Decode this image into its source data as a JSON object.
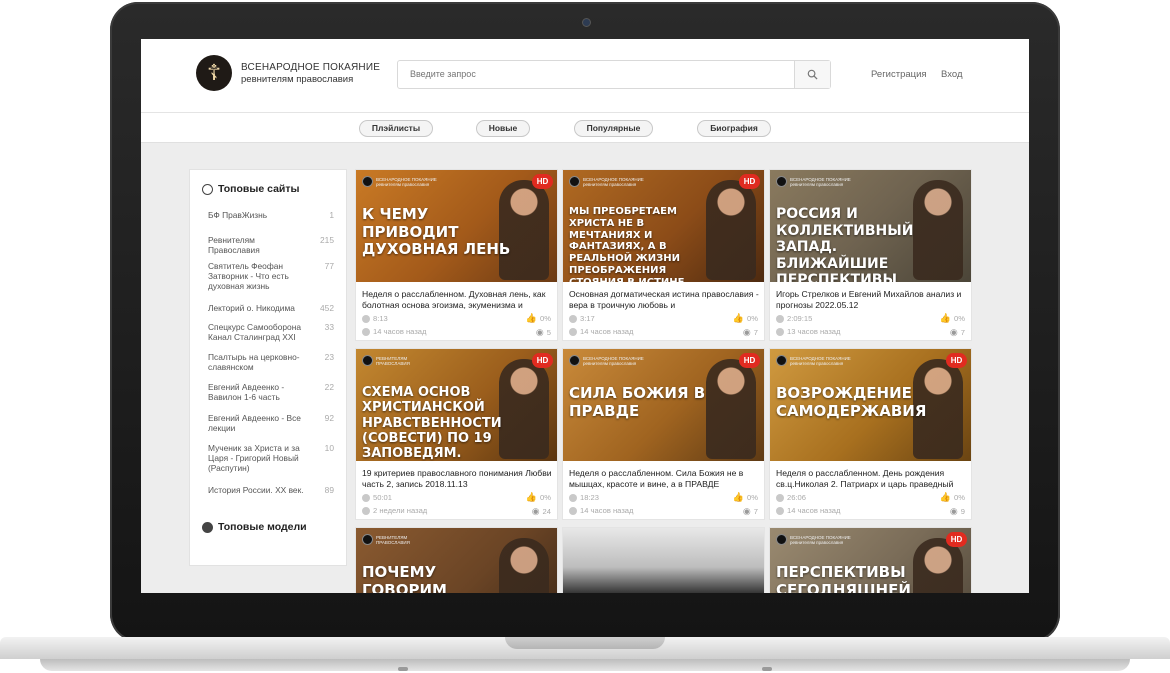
{
  "site": {
    "title": "ВСЕНАРОДНОЕ ПОКАЯНИЕ",
    "subtitle": "ревнителям православия",
    "logo_icon": "orthodox-cross-icon"
  },
  "search": {
    "placeholder": "Введите запрос"
  },
  "auth": {
    "register": "Регистрация",
    "login": "Вход"
  },
  "nav": {
    "tabs": [
      "Плэйлисты",
      "Новые",
      "Популярные",
      "Биография"
    ]
  },
  "sidebar": {
    "top_sites_heading": "Топовые сайты",
    "items": [
      {
        "label": "БФ ПравЖизнь",
        "count": "1"
      },
      {
        "label": "Ревнителям Православия",
        "count": "215"
      },
      {
        "label": "Святитель Феофан Затворник - Что есть духовная жизнь",
        "count": "77"
      },
      {
        "label": "Лекторий о. Никодима",
        "count": "452"
      },
      {
        "label": "Спецкурс Самооборона Канал Сталинград XXI",
        "count": "33"
      },
      {
        "label": "Псалтырь на церковно-славянском",
        "count": "23"
      },
      {
        "label": "Евгений Авдеенко - Вавилон 1-6 часть",
        "count": "22"
      },
      {
        "label": "Евгений Авдеенко - Все лекции",
        "count": "92"
      },
      {
        "label": "Мученик за Христа и за Царя - Григорий Новый (Распутин)",
        "count": "10"
      },
      {
        "label": "История России. XX век.",
        "count": "89"
      }
    ],
    "top_models_heading": "Топовые модели"
  },
  "brand_small": {
    "line1": "ВСЕНАРОДНОЕ ПОКАЯНИЕ",
    "line2": "ревнителям православия"
  },
  "brand_alt": {
    "line1": "РЕВНИТЕЛЯМ",
    "line2": "ПРАВОСЛАВИЯ"
  },
  "hd_label": "HD",
  "videos": [
    {
      "thumb_text": "К ЧЕМУ ПРИВОДИТ ДУХОВНАЯ ЛЕНЬ",
      "title": "Неделя о расслабленном. Духовная лень, как болотная основа эгоизма, экуменизма и",
      "duration": "8:13",
      "likes": "0%",
      "age": "14 часов назад",
      "views": "5",
      "hd": true,
      "brand": "small"
    },
    {
      "thumb_text": "МЫ ПРЕОБРЕТАЕМ ХРИСТА НЕ В МЕЧТАНИЯХ И ФАНТАЗИЯХ, А В РЕАЛЬНОЙ ЖИЗНИ ПРЕОБРАЖЕНИЯ СТОЯНИЯ В ИСТИНЕ",
      "title": "Основная догматическая истина православия - вера в троичную любовь и",
      "duration": "3:17",
      "likes": "0%",
      "age": "14 часов назад",
      "views": "7",
      "hd": true,
      "brand": "small"
    },
    {
      "thumb_text": "РОССИЯ И КОЛЛЕКТИВНЫЙ ЗАПАД. БЛИЖАЙШИЕ ПЕРСПЕКТИВЫ",
      "title": "Игорь Стрелков и Евгений Михайлов анализ и прогнозы 2022.05.12",
      "duration": "2:09:15",
      "likes": "0%",
      "age": "13 часов назад",
      "views": "7",
      "hd": false,
      "brand": "small"
    },
    {
      "thumb_text": "СХЕМА ОСНОВ ХРИСТИАНСКОЙ НРАВСТВЕННОСТИ (СОВЕСТИ) ПО 19 ЗАПОВЕДЯМ.",
      "title": "19 критериев православного понимания Любви часть 2, запись 2018.11.13",
      "duration": "50:01",
      "likes": "0%",
      "age": "2 недели назад",
      "views": "24",
      "hd": true,
      "brand": "alt"
    },
    {
      "thumb_text": "СИЛА БОЖИЯ В ПРАВДЕ",
      "title": "Неделя о расслабленном. Сила Божия не в мышцах, красоте и вине, а в ПРАВДЕ",
      "duration": "18:23",
      "likes": "0%",
      "age": "14 часов назад",
      "views": "7",
      "hd": true,
      "brand": "small"
    },
    {
      "thumb_text": "ВОЗРОЖДЕНИЕ САМОДЕРЖАВИЯ",
      "title": "Неделя о расслабленном. День рождения св.ц.Николая 2. Патриарх и царь праведный",
      "duration": "26:06",
      "likes": "0%",
      "age": "14 часов назад",
      "views": "9",
      "hd": true,
      "brand": "small"
    },
    {
      "thumb_text": "ПОЧЕМУ ГОВОРИМ ХРИСТОС ВОСКРЕСЕ",
      "title": "",
      "duration": "",
      "likes": "",
      "age": "",
      "views": "",
      "hd": false,
      "brand": "alt"
    },
    {
      "thumb_text": "",
      "title": "",
      "duration": "",
      "likes": "",
      "age": "",
      "views": "",
      "hd": false,
      "brand": "none"
    },
    {
      "thumb_text": "ПЕРСПЕКТИВЫ СЕГОДНЯШНЕЙ ВЛАСТИ",
      "title": "",
      "duration": "",
      "likes": "",
      "age": "",
      "views": "",
      "hd": true,
      "brand": "small"
    }
  ],
  "colors": {
    "hd_badge": "#e02b20",
    "like": "#2e6fd8",
    "thumb_orange": "#c8812c"
  }
}
